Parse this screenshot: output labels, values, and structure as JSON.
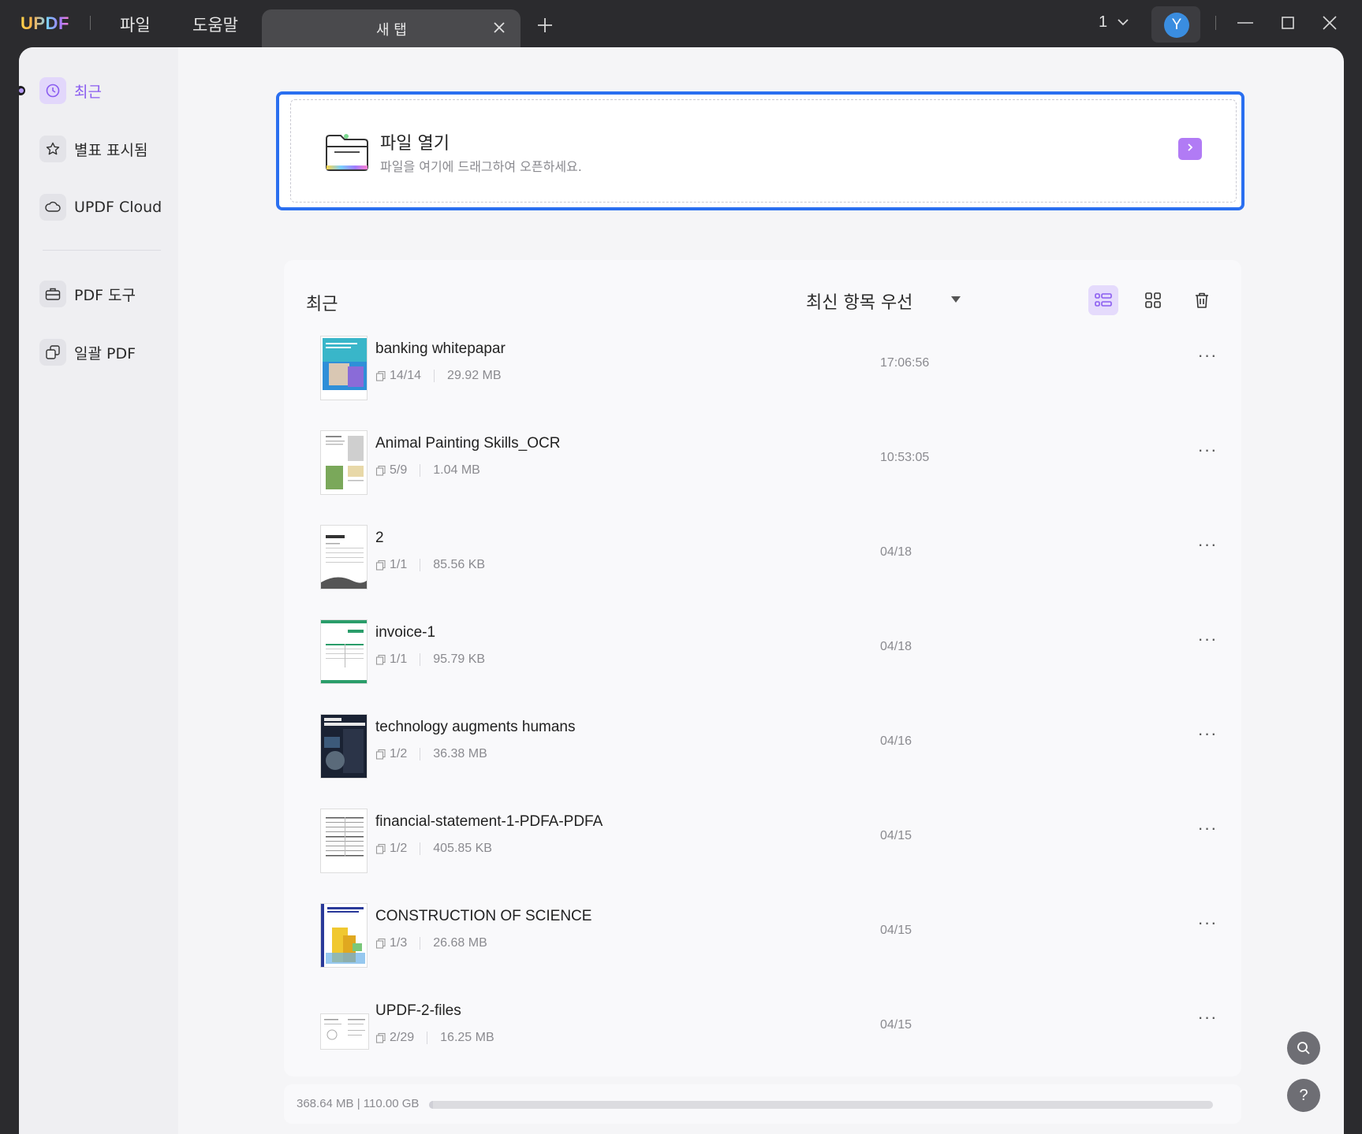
{
  "titlebar": {
    "logo": "UPDF",
    "menu": [
      "파일",
      "도움말"
    ],
    "tab_label": "새 탭",
    "window_count": "1",
    "avatar_letter": "Y"
  },
  "sidebar": {
    "items": [
      {
        "label": "최근",
        "icon": "clock-icon"
      },
      {
        "label": "별표 표시됨",
        "icon": "star-icon"
      },
      {
        "label": "UPDF Cloud",
        "icon": "cloud-icon"
      },
      {
        "label": "PDF 도구",
        "icon": "toolbox-icon"
      },
      {
        "label": "일괄 PDF",
        "icon": "batch-icon"
      }
    ]
  },
  "open_file": {
    "title": "파일 열기",
    "subtitle": "파일을 여기에 드래그하여 오픈하세요."
  },
  "recent": {
    "title": "최근",
    "sort_label": "최신 항목 우선",
    "files": [
      {
        "name": "banking whitepapar",
        "pages": "14/14",
        "size": "29.92 MB",
        "date": "17:06:56"
      },
      {
        "name": "Animal Painting Skills_OCR",
        "pages": "5/9",
        "size": "1.04 MB",
        "date": "10:53:05"
      },
      {
        "name": "2",
        "pages": "1/1",
        "size": "85.56 KB",
        "date": "04/18"
      },
      {
        "name": "invoice-1",
        "pages": "1/1",
        "size": "95.79 KB",
        "date": "04/18"
      },
      {
        "name": "technology augments humans",
        "pages": "1/2",
        "size": "36.38 MB",
        "date": "04/16"
      },
      {
        "name": "financial-statement-1-PDFA-PDFA",
        "pages": "1/2",
        "size": "405.85 KB",
        "date": "04/15"
      },
      {
        "name": "CONSTRUCTION OF SCIENCE",
        "pages": "1/3",
        "size": "26.68 MB",
        "date": "04/15"
      },
      {
        "name": "UPDF-2-files",
        "pages": "2/29",
        "size": "16.25 MB",
        "date": "04/15"
      }
    ]
  },
  "storage": {
    "text": "368.64 MB | 110.00 GB",
    "used_fraction": 0.0033
  },
  "colors": {
    "accent": "#8a5cf0",
    "focus_border": "#2a6ff0",
    "avatar": "#3a8de0"
  }
}
